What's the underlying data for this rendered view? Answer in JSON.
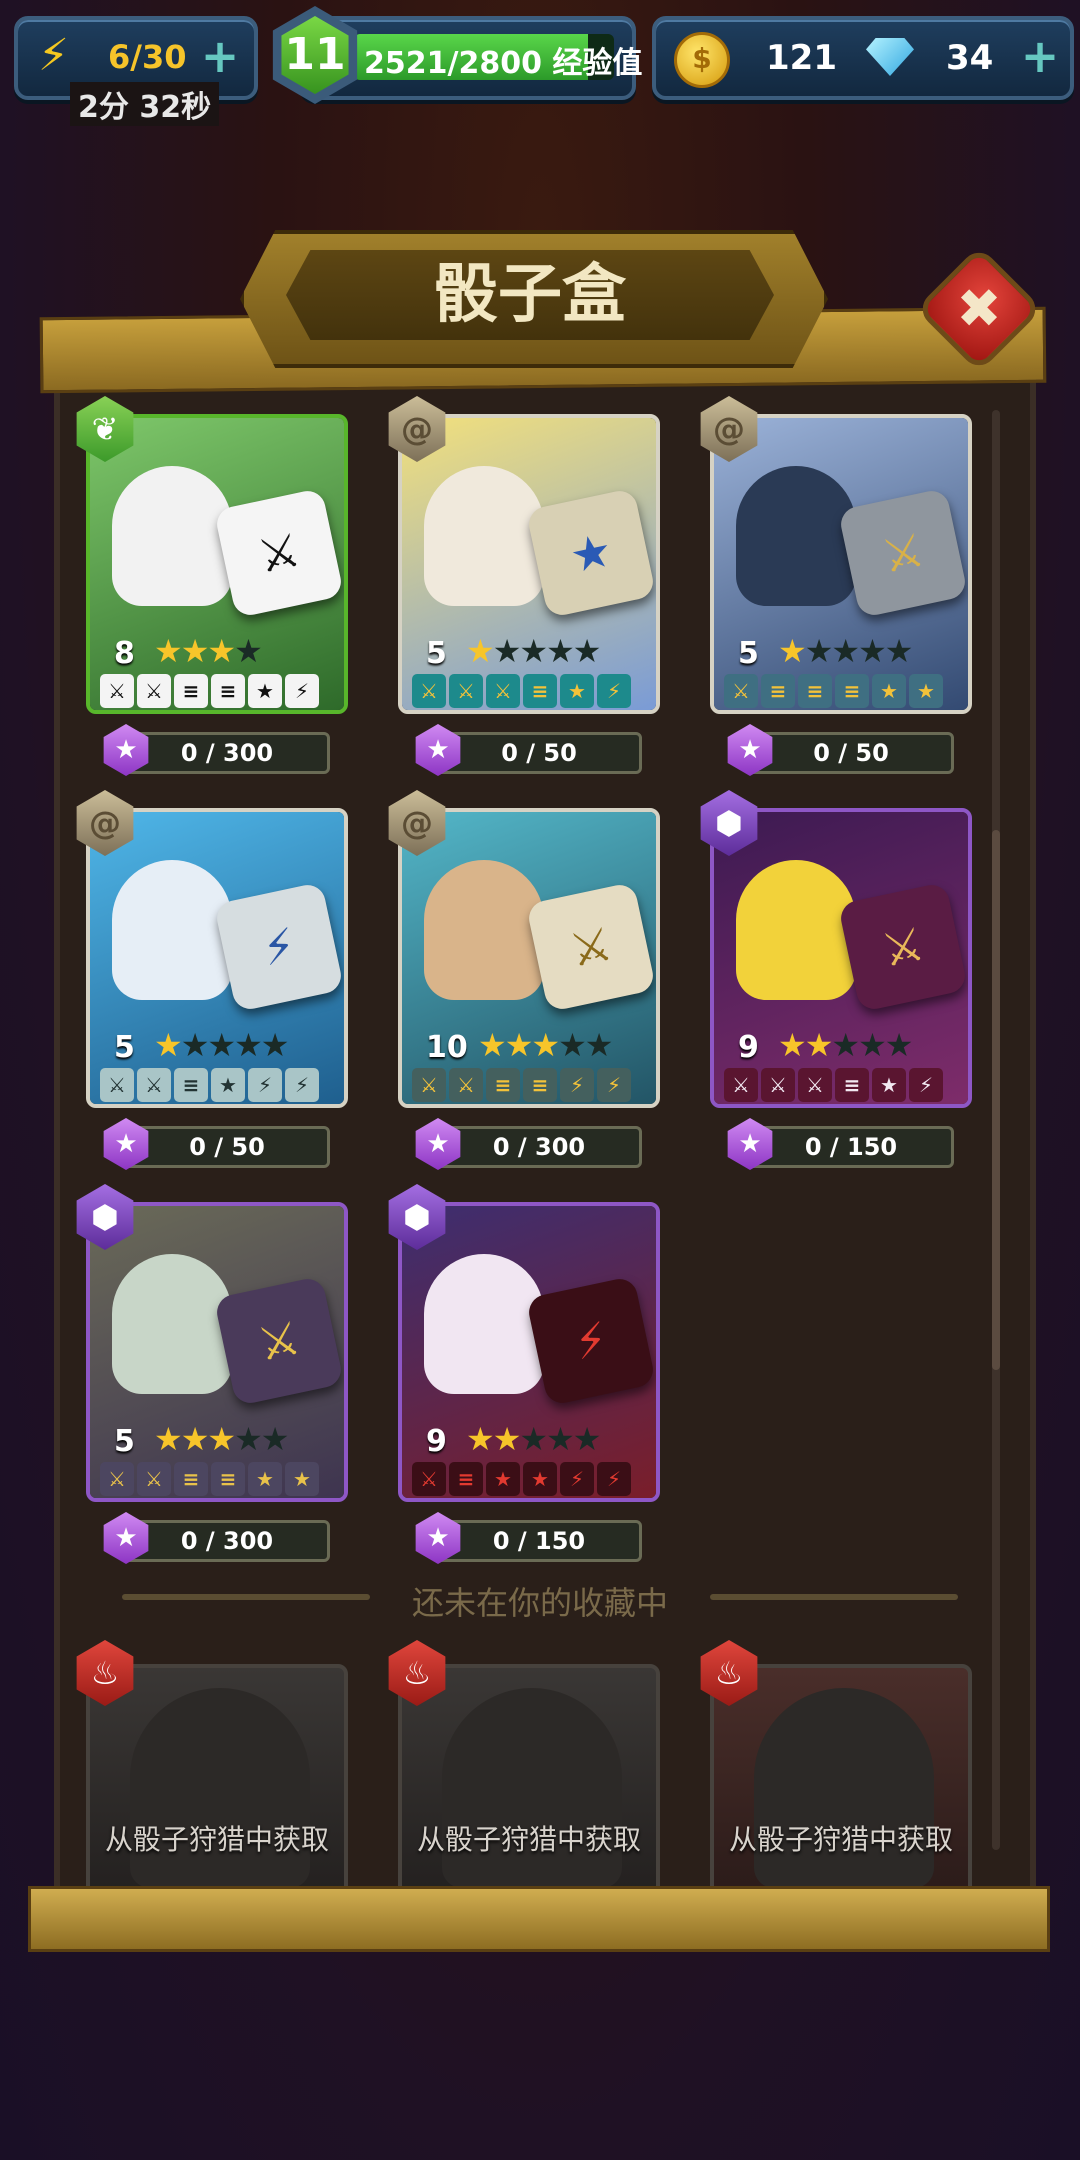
{
  "top_bar": {
    "energy": "6/30",
    "energy_timer": "2分 32秒",
    "level": "11",
    "xp_text": "2521/2800",
    "xp_label": "经验值",
    "xp_progress": 0.9,
    "coins": "121",
    "gems": "34"
  },
  "panel": {
    "title": "骰子盒",
    "close_label": "✖",
    "divider_text": "还未在你的收藏中"
  },
  "cards": [
    {
      "level": "8",
      "stars_on": 3,
      "stars_total": 4,
      "progress": "0 / 300",
      "rarity": "green",
      "badge_icon": "leaf-icon"
    },
    {
      "level": "5",
      "stars_on": 1,
      "stars_total": 5,
      "progress": "0 / 50",
      "rarity": "grey",
      "badge_icon": "swirl-icon"
    },
    {
      "level": "5",
      "stars_on": 1,
      "stars_total": 5,
      "progress": "0 / 50",
      "rarity": "grey",
      "badge_icon": "swirl-icon"
    },
    {
      "level": "5",
      "stars_on": 1,
      "stars_total": 5,
      "progress": "0 / 50",
      "rarity": "grey",
      "badge_icon": "swirl-icon"
    },
    {
      "level": "10",
      "stars_on": 3,
      "stars_total": 5,
      "progress": "0 / 300",
      "rarity": "grey",
      "badge_icon": "swirl-icon"
    },
    {
      "level": "9",
      "stars_on": 2,
      "stars_total": 5,
      "progress": "0 / 150",
      "rarity": "purple",
      "badge_icon": "hex-icon"
    },
    {
      "level": "5",
      "stars_on": 3,
      "stars_total": 5,
      "progress": "0 / 300",
      "rarity": "purple",
      "badge_icon": "hex-icon"
    },
    {
      "level": "9",
      "stars_on": 2,
      "stars_total": 5,
      "progress": "0 / 150",
      "rarity": "purple",
      "badge_icon": "hex-icon"
    }
  ],
  "locked_cards": [
    {
      "text": "从骰子狩猎中获取"
    },
    {
      "text": "从骰子狩猎中获取"
    },
    {
      "text": "从骰子狩猎中获取"
    }
  ],
  "colors": {
    "green_rarity": "#58b62b",
    "grey_rarity": "#d6d2c4",
    "purple_rarity": "#8e57c6",
    "red_rarity": "#d13a30"
  }
}
